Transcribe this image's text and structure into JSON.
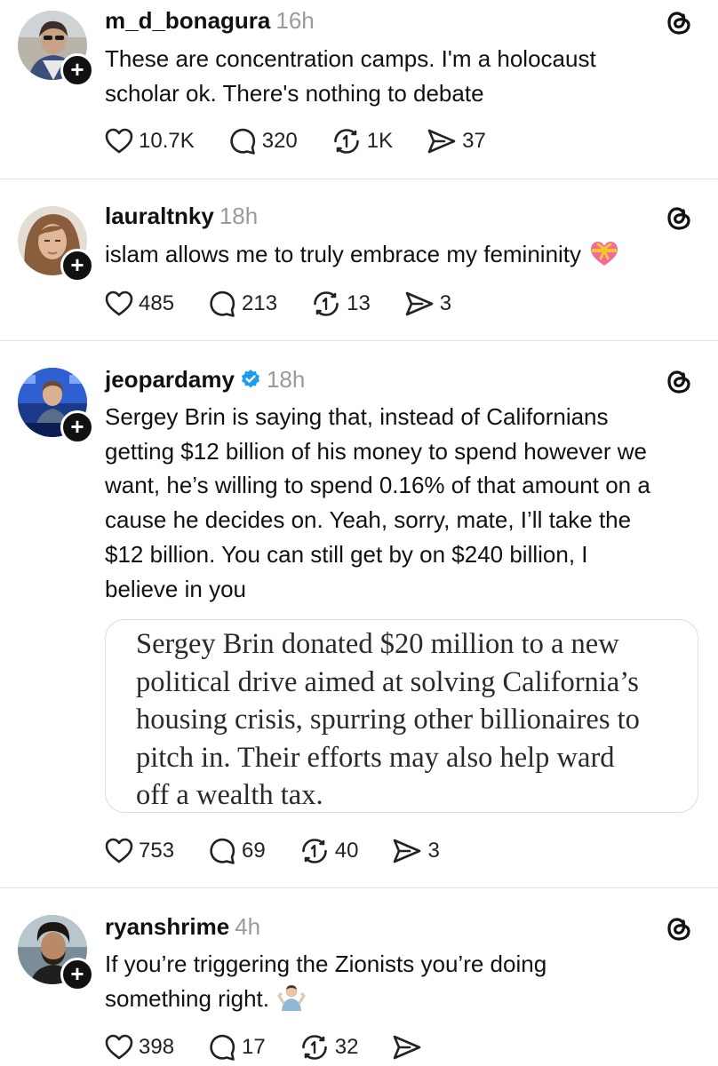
{
  "posts": [
    {
      "username": "m_d_bonagura",
      "time": "16h",
      "verified": false,
      "text_lines": [
        "These are concentration camps. I'm a holocaust",
        "scholar ok. There's nothing to debate"
      ],
      "likes": "10.7K",
      "replies": "320",
      "reposts": "1K",
      "shares": "37"
    },
    {
      "username": "lauraltnky",
      "time": "18h",
      "verified": false,
      "text_lines": [
        "islam allows me to truly embrace my femininity"
      ],
      "emoji": "heart-with-ribbon",
      "likes": "485",
      "replies": "213",
      "reposts": "13",
      "shares": "3"
    },
    {
      "username": "jeopardamy",
      "time": "18h",
      "verified": true,
      "text_lines": [
        "Sergey Brin is saying that, instead of Californians",
        "getting $12 billion of his money to spend however we",
        "want, he’s willing to spend 0.16% of that amount on a",
        "cause he decides on. Yeah, sorry, mate, I’ll take the",
        "$12 billion. You can still get by on $240 billion, I",
        "believe in you"
      ],
      "quote_lines": [
        "Sergey Brin donated $20 million to a new",
        "political drive aimed at solving California’s",
        "housing crisis, spurring other billionaires to",
        "pitch in. Their efforts may also help ward",
        "off a wealth tax."
      ],
      "likes": "753",
      "replies": "69",
      "reposts": "40",
      "shares": "3"
    },
    {
      "username": "ryanshrime",
      "time": "4h",
      "verified": false,
      "text_lines": [
        "If you’re triggering the Zionists you’re doing",
        "something right."
      ],
      "emoji": "person-shrugging",
      "likes": "398",
      "replies": "17",
      "reposts": "32",
      "shares": ""
    }
  ],
  "colors": {
    "text": "#111111",
    "muted": "#9a9a9a",
    "verified": "#1d9bf0",
    "divider": "#e2e2e2"
  }
}
